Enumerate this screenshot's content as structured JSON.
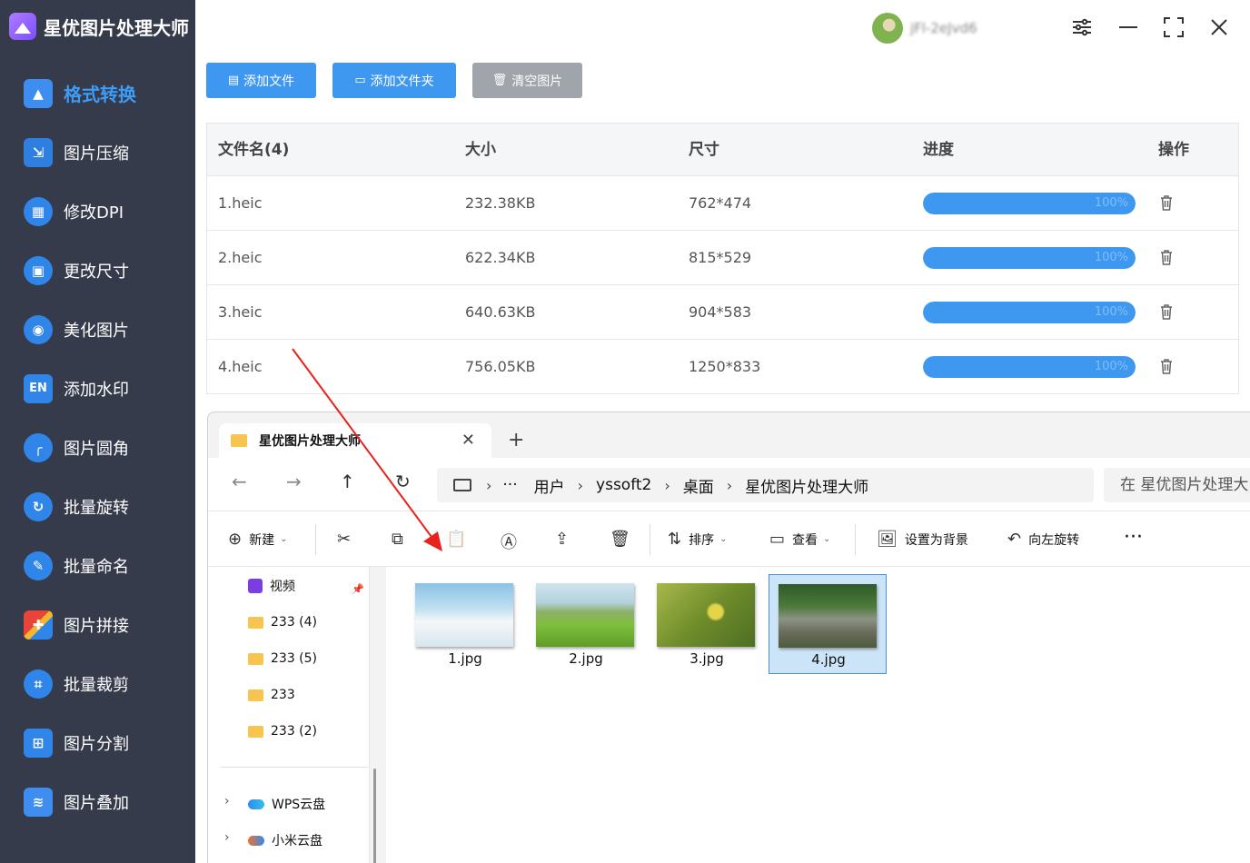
{
  "app": {
    "title": "星优图片处理大师"
  },
  "user": {
    "name": "jFl-2eJvd6"
  },
  "sidebar": {
    "items": [
      {
        "label": "格式转换",
        "icon": "format-convert-icon",
        "active": true
      },
      {
        "label": "图片压缩",
        "icon": "compress-icon"
      },
      {
        "label": "修改DPI",
        "icon": "dpi-icon"
      },
      {
        "label": "更改尺寸",
        "icon": "resize-icon"
      },
      {
        "label": "美化图片",
        "icon": "beautify-icon"
      },
      {
        "label": "添加水印",
        "icon": "watermark-icon"
      },
      {
        "label": "图片圆角",
        "icon": "round-corner-icon"
      },
      {
        "label": "批量旋转",
        "icon": "rotate-icon"
      },
      {
        "label": "批量命名",
        "icon": "rename-icon"
      },
      {
        "label": "图片拼接",
        "icon": "puzzle-icon"
      },
      {
        "label": "批量裁剪",
        "icon": "crop-icon"
      },
      {
        "label": "图片分割",
        "icon": "split-icon"
      },
      {
        "label": "图片叠加",
        "icon": "layers-icon"
      }
    ]
  },
  "toolbar": {
    "add_file": "添加文件",
    "add_folder": "添加文件夹",
    "clear": "清空图片"
  },
  "table": {
    "headers": {
      "name": "文件名(4)",
      "size": "大小",
      "dims": "尺寸",
      "progress": "进度",
      "actions": "操作"
    },
    "rows": [
      {
        "name": "1.heic",
        "size": "232.38KB",
        "dims": "762*474",
        "progress": 1.0,
        "progress_label": "100%"
      },
      {
        "name": "2.heic",
        "size": "622.34KB",
        "dims": "815*529",
        "progress": 1.0,
        "progress_label": "100%"
      },
      {
        "name": "3.heic",
        "size": "640.63KB",
        "dims": "904*583",
        "progress": 1.0,
        "progress_label": "100%"
      },
      {
        "name": "4.heic",
        "size": "756.05KB",
        "dims": "1250*833",
        "progress": 1.0,
        "progress_label": "100%"
      }
    ]
  },
  "explorer": {
    "tab_title": "星优图片处理大师",
    "breadcrumbs": [
      "用户",
      "yssoft2",
      "桌面",
      "星优图片处理大师"
    ],
    "search_placeholder": "在 星优图片处理大师 中搜索",
    "commands": {
      "new": "新建",
      "sort": "排序",
      "view": "查看",
      "set_background": "设置为背景",
      "rotate_left": "向左旋转"
    },
    "nav_pane": {
      "items": [
        "视频",
        "233 (4)",
        "233 (5)",
        "233",
        "233 (2)"
      ],
      "clouds": [
        "WPS云盘",
        "小米云盘"
      ]
    },
    "files": [
      {
        "name": "1.jpg",
        "selected": false
      },
      {
        "name": "2.jpg",
        "selected": false
      },
      {
        "name": "3.jpg",
        "selected": false
      },
      {
        "name": "4.jpg",
        "selected": true
      }
    ]
  },
  "colors": {
    "sidebar_bg": "#353b4b",
    "accent": "#3d9cf6",
    "primary_button": "#3e98ef",
    "clear_button": "#a0a4ab",
    "arrow": "#e8221c"
  }
}
